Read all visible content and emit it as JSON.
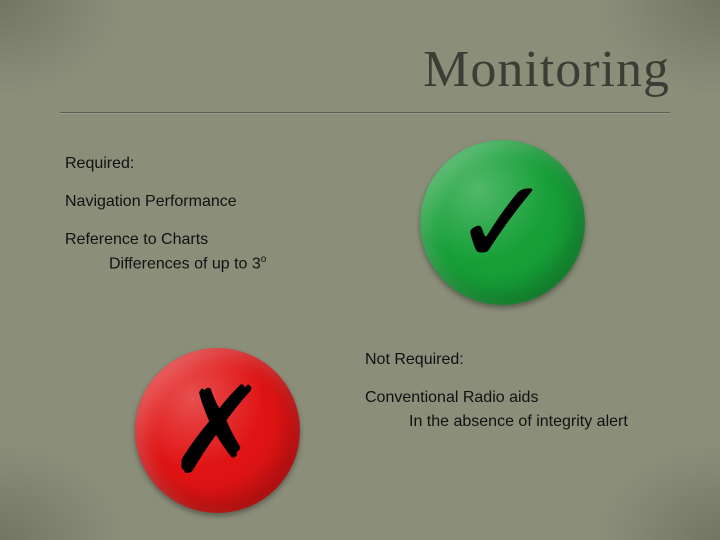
{
  "title": "Monitoring",
  "required": {
    "heading": "Required:",
    "item1": "Navigation Performance",
    "item2": "Reference to Charts",
    "item2_sub": "Differences of up to 3",
    "item2_sub_sup": "o"
  },
  "not_required": {
    "heading": "Not Required:",
    "item1": "Conventional Radio aids",
    "item1_sub": "In the absence of integrity alert"
  },
  "icons": {
    "check": "✓",
    "cross": "✗"
  }
}
